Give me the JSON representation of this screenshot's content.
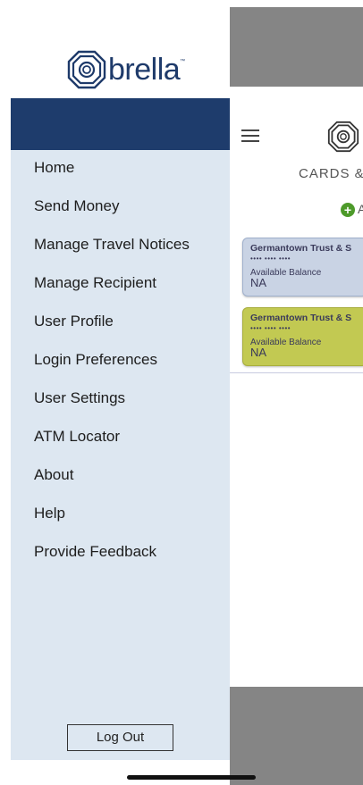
{
  "brand": {
    "name": "brella",
    "tm": "™"
  },
  "sidebar": {
    "items": [
      {
        "label": "Home"
      },
      {
        "label": "Send Money"
      },
      {
        "label": "Manage Travel Notices"
      },
      {
        "label": "Manage Recipient"
      },
      {
        "label": "User Profile"
      },
      {
        "label": "Login Preferences"
      },
      {
        "label": "User Settings"
      },
      {
        "label": "ATM Locator"
      },
      {
        "label": "About"
      },
      {
        "label": "Help"
      },
      {
        "label": "Provide Feedback"
      }
    ],
    "logout_label": "Log Out"
  },
  "background_screen": {
    "title": "CARDS &",
    "add_label": "A",
    "cards": [
      {
        "bank": "Germantown Trust & S",
        "number": "•••• •••• ••••",
        "balance_label": "Available Balance",
        "balance": "NA",
        "color": "#c9d3e4"
      },
      {
        "bank": "Germantown Trust & S",
        "number": "•••• •••• ••••",
        "balance_label": "Available Balance",
        "balance": "NA",
        "color": "#c2c952"
      }
    ]
  },
  "colors": {
    "drawer_bg": "#dde7f1",
    "header_band": "#1e3c6c",
    "brand_text": "#1e3a6a",
    "dim_overlay": "#858585"
  },
  "icons": [
    "brella-logo-icon",
    "hamburger-menu-icon",
    "add-circle-icon"
  ]
}
